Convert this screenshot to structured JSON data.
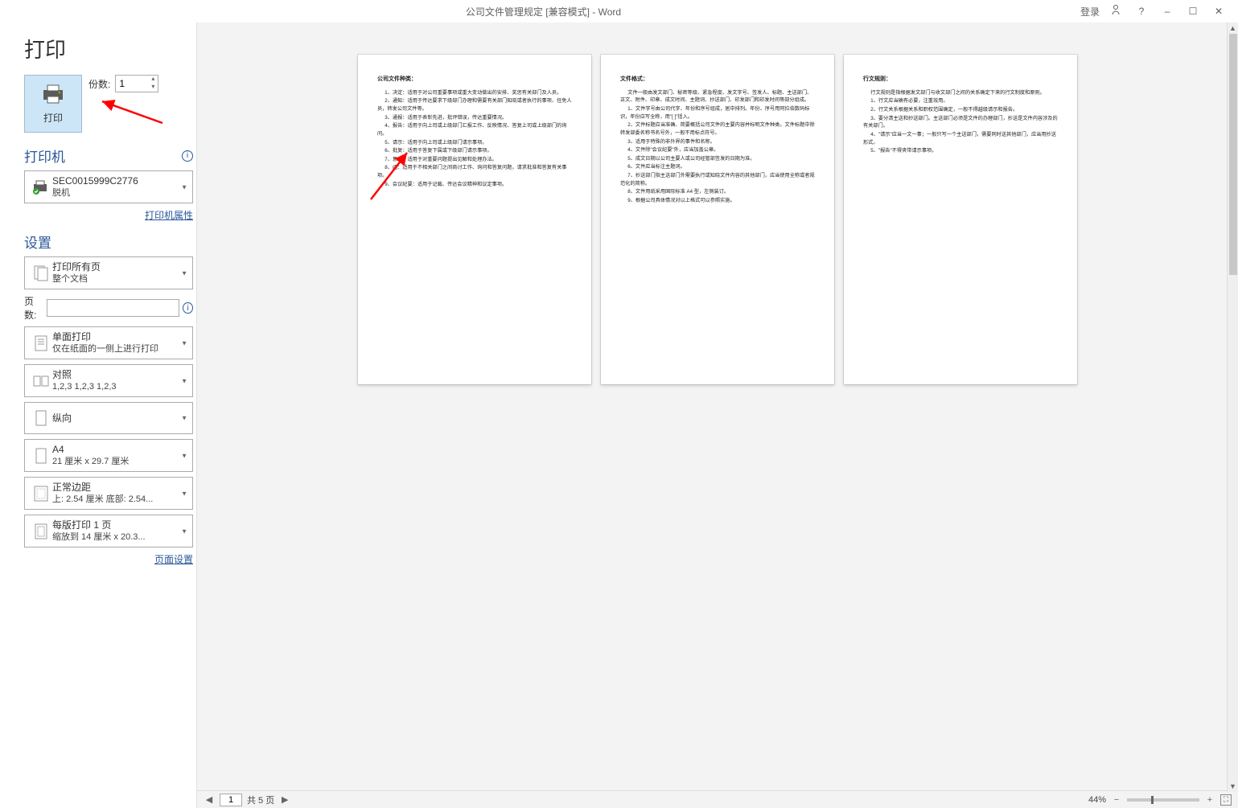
{
  "app": {
    "title": "公司文件管理规定 [兼容模式] - Word",
    "signin": "登录",
    "share_icon": "share-icon",
    "help": "?",
    "minimize": "–",
    "maximize": "☐",
    "close": "✕"
  },
  "screen_h1": "打印",
  "print_btn_label": "打印",
  "copies": {
    "label": "份数:",
    "value": "1"
  },
  "printer_section": "打印机",
  "printer": {
    "name": "SEC0015999C2776",
    "status": "脱机"
  },
  "printer_props_link": "打印机属性",
  "settings_section": "设置",
  "scope": {
    "line1": "打印所有页",
    "line2": "整个文档"
  },
  "pages_label": "页数:",
  "pages_value": "",
  "duplex": {
    "line1": "单面打印",
    "line2": "仅在纸面的一侧上进行打印"
  },
  "collate": {
    "line1": "对照",
    "line2": "1,2,3    1,2,3    1,2,3"
  },
  "orientation": {
    "line1": "纵向"
  },
  "paper": {
    "line1": "A4",
    "line2": "21 厘米 x 29.7 厘米"
  },
  "margins": {
    "line1": "正常边距",
    "line2": "上: 2.54 厘米 底部: 2.54..."
  },
  "pages_per": {
    "line1": "每版打印 1 页",
    "line2": "缩放到 14 厘米 x 20.3..."
  },
  "page_setup_link": "页面设置",
  "preview": {
    "page1_title": "公司文件种类：",
    "page1_body": [
      "1、决定：适用于对公司重要事项或重大变动做出的安排、奖惩有关部门及人员。",
      "2、通知：适用于传达要求下级部门办理和需要有关部门知晓或者执行的事项、任免人员，转发公司文件等。",
      "3、通报：适用于表彰先进，批评错误，传达重要情况。",
      "4、报告：适用于向上司或上级部门汇报工作、反映情况、答复上司或上级部门的询问。",
      "5、请示：适用于向上司或上级部门请示事项。",
      "6、批复：适用于答复下属或下级部门请示事项。",
      "7、意见：适用于对重要问题提出见解和处理办法。",
      "8、函：适用于不相关部门之间商讨工作、询问和答复问题，请求批准和答复有关事项。",
      "9、会议纪要：适用于记载、传达会议精神和议定事项。"
    ],
    "page2_title": "文件格式：",
    "page2_body": [
      "文件一般由发文部门、秘密等级、紧急程度、发文字号、签发人、标题、主送部门、正文、附件、印章、成文时间、主题词、抄送部门、印发部门和印发时间等部分组成。",
      "1、文件字号由公司代字、年份和序号组成，居中排列。年份、序号用阿拉伯数码标识，年份应写全称，用\"[  ]\"括入。",
      "2、文件标题应当准确、简要概括公司文件的主要内容并标明文件种类。文件标题中除转发部委名称书名号外，一般不用标点符号。",
      "3、适用于特殊的非外界的事件和名称。",
      "4、文件除\"会议纪要\"外，应当加盖公章。",
      "5、成文日期以公司主要人或公司经管部签发的日期为准。",
      "6、文件应当标注主题词。",
      "7、抄送部门指主送部门外需要执行或知晓文件内容的其他部门，应当使用全称或者规范化的简称。",
      "8、文件用纸采用国际标准 A4 型，左侧装订。",
      "9、根据公司具体情况对以上格式可以参照实施。"
    ],
    "page3_title": "行文规则：",
    "page3_body": [
      "行文规则是指根据发文部门与收文部门之间的关系确定下来的行文制度和原则。",
      "1、行文应当确有必要，注重效用。",
      "2、行文关系根据关系和职权范围确定，一般不得越级请示和报告。",
      "3、要分清主送和抄送部门。主送部门必须是文件的办理部门，抄送是文件内容涉及的有关部门。",
      "4、\"请示\"应当一文一事；一般只写一个主送部门，需要同时送其他部门，应当用抄送形式。",
      "5、\"报告\"不得夹带请示事项。"
    ]
  },
  "footer": {
    "current_page": "1",
    "total_text": "共 5 页",
    "zoom": "44%"
  }
}
